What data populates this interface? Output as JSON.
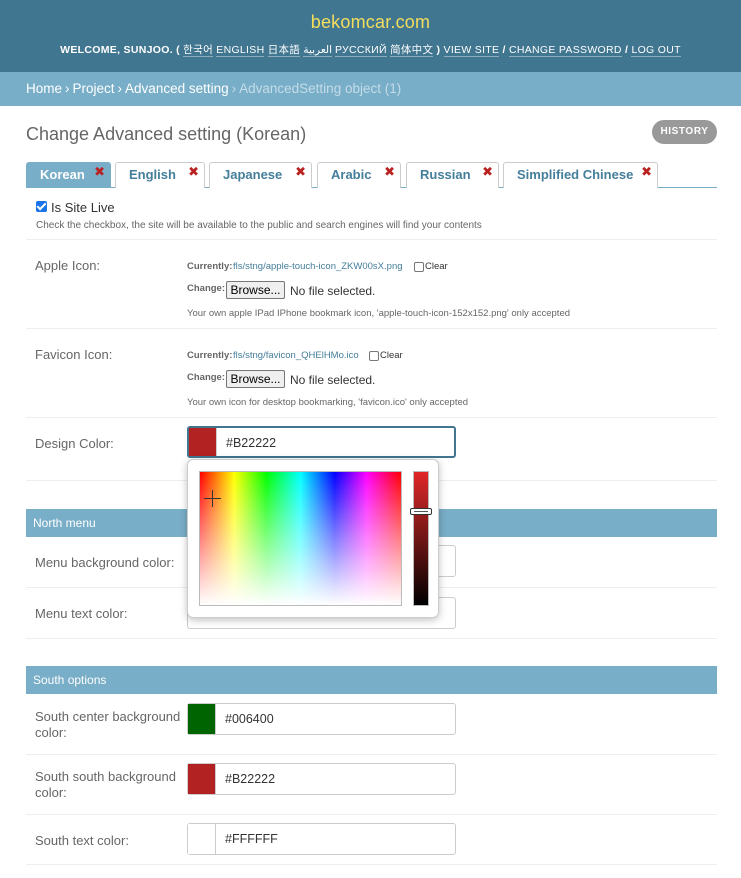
{
  "header": {
    "site_name": "bekomcar.com",
    "welcome": "WELCOME,",
    "username": "SUNJOO",
    "paren_open": ". (",
    "languages": [
      "한국어",
      "ENGLISH",
      "日本語",
      "العربية",
      "РУССКИЙ",
      "简体中文"
    ],
    "paren_close": ")",
    "view_site": "VIEW SITE",
    "change_password": "CHANGE PASSWORD",
    "log_out": "LOG OUT"
  },
  "breadcrumbs": {
    "home": "Home",
    "project": "Project",
    "model": "Advanced setting",
    "current": "AdvancedSetting object (1)",
    "separator": "›"
  },
  "page": {
    "title": "Change Advanced setting (Korean)",
    "history_button": "HISTORY"
  },
  "tabs": [
    {
      "label": "Korean",
      "active": true
    },
    {
      "label": "English",
      "active": false
    },
    {
      "label": "Japanese",
      "active": false
    },
    {
      "label": "Arabic",
      "active": false
    },
    {
      "label": "Russian",
      "active": false
    },
    {
      "label": "Simplified Chinese",
      "active": false
    }
  ],
  "tab_close_glyph": "✖",
  "site_live": {
    "label": "Is Site Live",
    "checked": true,
    "help": "Check the checkbox, the site will be available to the public and search engines will find your contents"
  },
  "apple_icon": {
    "label": "Apple Icon:",
    "currently_label": "Currently:",
    "current_file": "fls/stng/apple-touch-icon_ZKW00sX.png",
    "clear_label": "Clear",
    "change_label": "Change:",
    "browse_label": "Browse...",
    "no_file": "No file selected.",
    "help": "Your own apple IPad IPhone bookmark icon, 'apple-touch-icon-152x152.png' only accepted"
  },
  "favicon_icon": {
    "label": "Favicon Icon:",
    "currently_label": "Currently:",
    "current_file": "fls/stng/favicon_QHElHMo.ico",
    "clear_label": "Clear",
    "change_label": "Change:",
    "browse_label": "Browse...",
    "no_file": "No file selected.",
    "help": "Your own icon for desktop bookmarking, 'favicon.ico' only accepted"
  },
  "design_color": {
    "label": "Design Color:",
    "value": "#B22222",
    "swatch": "#B22222"
  },
  "north_menu": {
    "caption": "North menu",
    "menu_bg_label": "Menu background color:",
    "menu_text_label": "Menu text color:"
  },
  "south_options": {
    "caption": "South options",
    "center_bg_label": "South center background color:",
    "center_bg_value": "#006400",
    "center_bg_swatch": "#006400",
    "south_bg_label": "South south background color:",
    "south_bg_value": "#B22222",
    "south_bg_swatch": "#B22222",
    "text_label": "South text color:",
    "text_value": "#FFFFFF",
    "text_swatch": "#FFFFFF"
  },
  "colors": {
    "header_bg": "#417690",
    "breadcrumb_bg": "#79aec8",
    "brand_text": "#f5dd5d",
    "link": "#447e9b",
    "delete_red": "#ba2121"
  }
}
